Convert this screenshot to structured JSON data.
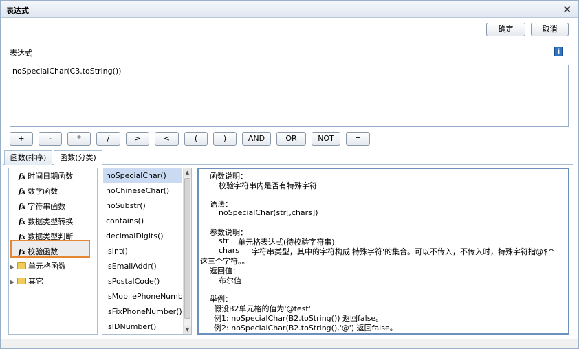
{
  "dialog": {
    "title": "表达式",
    "close": "×",
    "ok_label": "确定",
    "cancel_label": "取消",
    "expr_label": "表达式",
    "info_icon_glyph": "i",
    "expression_value": "noSpecialChar(C3.toString())"
  },
  "operators": [
    "+",
    "-",
    "*",
    "/",
    ">",
    "<",
    "(",
    ")",
    "AND",
    "OR",
    "NOT",
    "="
  ],
  "tabs": [
    "函数(排序)",
    "函数(分类)"
  ],
  "categories": [
    "时间日期函数",
    "数学函数",
    "字符串函数",
    "数据类型转换",
    "数据类型判断",
    "校验函数"
  ],
  "folders": [
    "单元格函数",
    "其它"
  ],
  "functions": [
    "noSpecialChar()",
    "noChineseChar()",
    "noSubstr()",
    "contains()",
    "decimalDigits()",
    "isInt()",
    "isEmailAddr()",
    "isPostalCode()",
    "isMobilePhoneNumber()",
    "isFixPhoneNumber()",
    "isIDNumber()"
  ],
  "description": [
    "函数说明：",
    "校验字符串内是否有特殊字符",
    "语法：",
    "noSpecialChar(str[,chars])",
    "参数说明：",
    "str",
    "单元格表达式(待校验字符串)",
    "chars",
    "字符串类型，其中的字符构成'特殊字符'的集合。可以不传入，不传入时，特殊字符指@$^",
    "这三个字符。。",
    "返回值：",
    "布尔值",
    "举例：",
    "假设B2单元格的值为'@test'",
    "例1:  noSpecialChar(B2.toString())  返回false。",
    "例2:  noSpecialChar(B2.toString(),'@')   返回false。"
  ],
  "colors": {
    "title_gradient_top": "#f4f7fb",
    "panel_border": "#a9bfd6",
    "selected_category_border": "#e58633",
    "selected_function_bg": "#c9daf2",
    "folder": "#f2cc5a"
  }
}
